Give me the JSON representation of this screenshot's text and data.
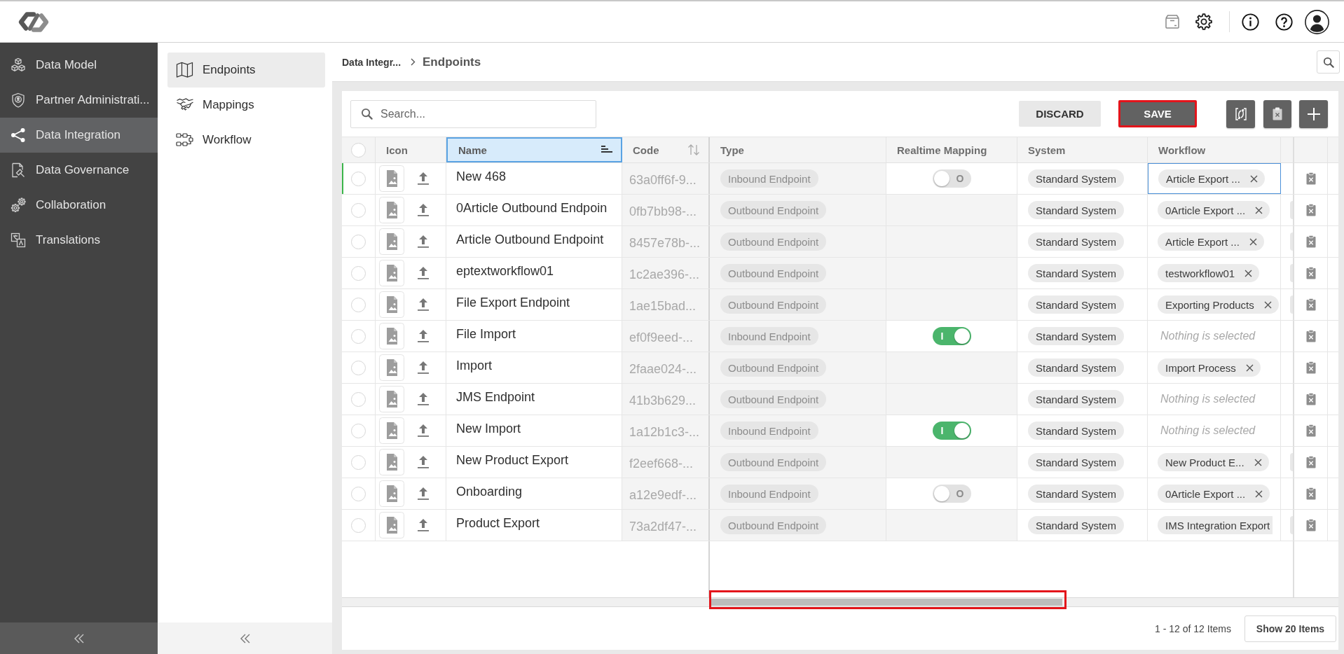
{
  "sidebar": {
    "items": [
      {
        "label": "Data Model",
        "selected": false
      },
      {
        "label": "Partner Administrati...",
        "selected": false
      },
      {
        "label": "Data Integration",
        "selected": true
      },
      {
        "label": "Data Governance",
        "selected": false
      },
      {
        "label": "Collaboration",
        "selected": false
      },
      {
        "label": "Translations",
        "selected": false
      }
    ]
  },
  "subnav": {
    "items": [
      {
        "label": "Endpoints",
        "selected": true
      },
      {
        "label": "Mappings",
        "selected": false
      },
      {
        "label": "Workflow",
        "selected": false
      }
    ]
  },
  "breadcrumb": {
    "parent": "Data Integr...",
    "current": "Endpoints"
  },
  "toolbar": {
    "search": {
      "placeholder": "Search..."
    },
    "buttons": [
      {
        "label": "DISCARD",
        "kind": "secondary",
        "highlighted": false
      },
      {
        "label": "SAVE",
        "kind": "primary",
        "highlighted": true
      }
    ]
  },
  "table": {
    "select_all": {
      "checked": false
    },
    "columns": [
      {
        "label": "Icon",
        "selected": false,
        "kind": "plain"
      },
      {
        "label": "Name",
        "selected": true,
        "kind": "sorted"
      },
      {
        "label": "Code",
        "selected": false,
        "kind": "sortable"
      },
      {
        "label": "Type",
        "selected": false,
        "kind": "plain"
      },
      {
        "label": "Realtime Mapping",
        "selected": false,
        "kind": "plain"
      },
      {
        "label": "System",
        "selected": false,
        "kind": "plain"
      },
      {
        "label": "Workflow",
        "selected": false,
        "kind": "plain"
      }
    ],
    "rows": [
      {
        "checked": false,
        "modified": true,
        "name": "New 468",
        "code": "63a0ff6f-9...",
        "type": "Inbound Endpoint",
        "realtime_mapping": {
          "on": false,
          "label": "O"
        },
        "system": "Standard System",
        "workflow": {
          "value": "Article Export ...",
          "focused": true,
          "clipped": false
        },
        "column_9_tag": false
      },
      {
        "checked": false,
        "modified": false,
        "name": "0Article Outbound Endpoin",
        "code": "0fb7bb98-...",
        "type": "Outbound Endpoint",
        "system": "Standard System",
        "workflow": {
          "value": "0Article Export ...",
          "focused": false,
          "clipped": false
        },
        "column_9_tag": true
      },
      {
        "checked": false,
        "modified": false,
        "name": "Article Outbound Endpoint",
        "code": "8457e78b-...",
        "type": "Outbound Endpoint",
        "system": "Standard System",
        "workflow": {
          "value": "Article Export ...",
          "focused": false,
          "clipped": false
        },
        "column_9_tag": true
      },
      {
        "checked": false,
        "modified": false,
        "name": "eptextworkflow01",
        "code": "1c2ae396-...",
        "type": "Outbound Endpoint",
        "system": "Standard System",
        "workflow": {
          "value": "testworkflow01",
          "focused": false,
          "clipped": false
        },
        "column_9_tag": true
      },
      {
        "checked": false,
        "modified": false,
        "name": "File Export Endpoint",
        "code": "1ae15bad...",
        "type": "Outbound Endpoint",
        "system": "Standard System",
        "workflow": {
          "value": "Exporting Products",
          "focused": false,
          "clipped": false
        },
        "column_9_tag": true
      },
      {
        "checked": false,
        "modified": false,
        "name": "File Import",
        "code": "ef0f9eed-...",
        "type": "Inbound Endpoint",
        "realtime_mapping": {
          "on": true,
          "label": "I"
        },
        "system": "Standard System",
        "workflow": {
          "placeholder": "Nothing is selected",
          "focused": false
        },
        "column_9_tag": false
      },
      {
        "checked": false,
        "modified": false,
        "name": "Import",
        "code": "2faae024-...",
        "type": "Outbound Endpoint",
        "system": "Standard System",
        "workflow": {
          "value": "Import Process",
          "focused": false,
          "clipped": false
        },
        "column_9_tag": false
      },
      {
        "checked": false,
        "modified": false,
        "name": "JMS Endpoint",
        "code": "41b3b629...",
        "type": "Outbound Endpoint",
        "system": "Standard System",
        "workflow": {
          "placeholder": "Nothing is selected",
          "focused": false
        },
        "column_9_tag": false
      },
      {
        "checked": false,
        "modified": false,
        "name": "New Import",
        "code": "1a12b1c3-...",
        "type": "Inbound Endpoint",
        "realtime_mapping": {
          "on": true,
          "label": "I"
        },
        "system": "Standard System",
        "workflow": {
          "placeholder": "Nothing is selected",
          "focused": false
        },
        "column_9_tag": false
      },
      {
        "checked": false,
        "modified": false,
        "name": "New Product Export",
        "code": "f2eef668-...",
        "type": "Outbound Endpoint",
        "system": "Standard System",
        "workflow": {
          "value": "New Product E...",
          "focused": false,
          "clipped": false
        },
        "column_9_tag": true
      },
      {
        "checked": false,
        "modified": false,
        "name": "Onboarding",
        "code": "a12e9edf-...",
        "type": "Inbound Endpoint",
        "realtime_mapping": {
          "on": false,
          "label": "O"
        },
        "system": "Standard System",
        "workflow": {
          "value": "0Article Export ...",
          "focused": false,
          "clipped": false
        },
        "column_9_tag": false
      },
      {
        "checked": false,
        "modified": false,
        "name": "Product Export",
        "code": "73a2df47-...",
        "type": "Outbound Endpoint",
        "system": "Standard System",
        "workflow": {
          "value": "IMS Integration Export",
          "focused": false,
          "clipped": true
        },
        "column_9_tag": true
      }
    ],
    "scrollbar": {
      "highlighted": true
    }
  },
  "pager": {
    "summary": "1 - 12 of 12 Items",
    "page_size_button": "Show 20 Items"
  }
}
